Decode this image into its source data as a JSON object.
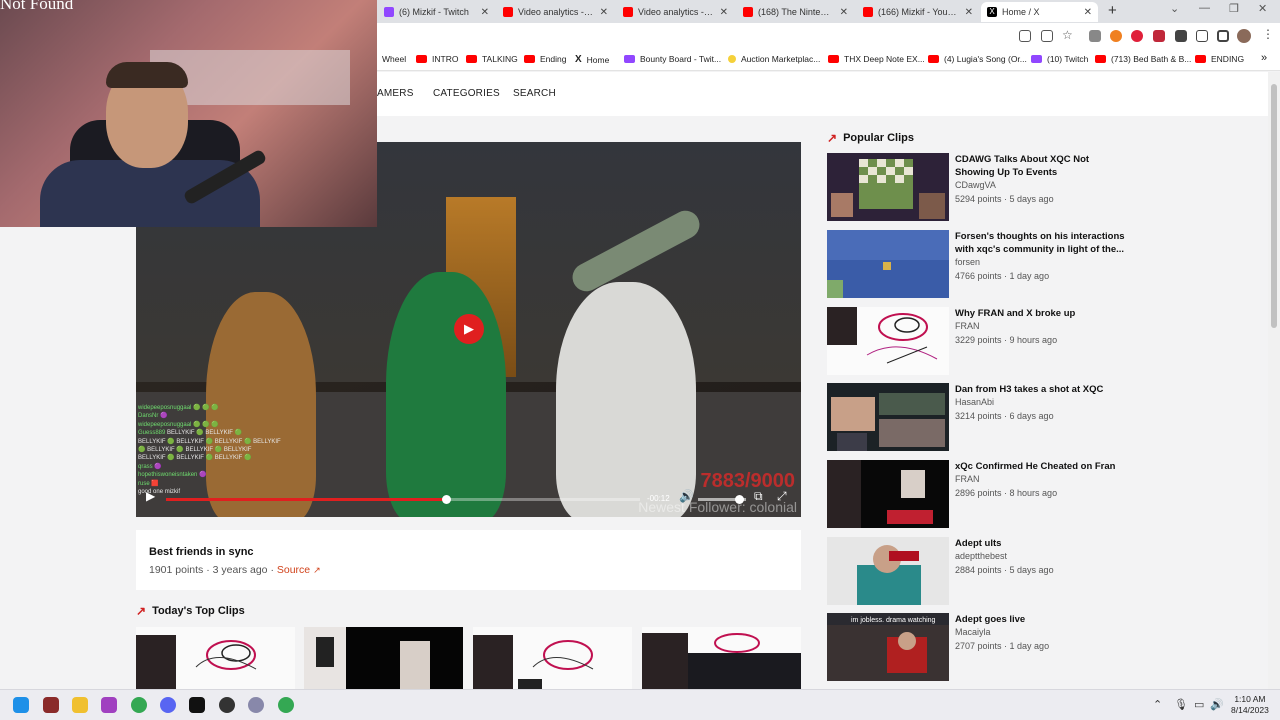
{
  "browser": {
    "tabs": [
      {
        "title": "(6) Mizkif - Twitch",
        "color": "#9147ff"
      },
      {
        "title": "Video analytics - YouTube",
        "color": "#ff0000"
      },
      {
        "title": "Video analytics - YouTube",
        "color": "#ff0000"
      },
      {
        "title": "(168) The Nintendo Ic",
        "color": "#ff0000"
      },
      {
        "title": "(166) Mizkif - YouTube",
        "color": "#ff0000"
      },
      {
        "title": "Home / X",
        "color": "#000000"
      }
    ],
    "new_tab": "+",
    "window_controls": [
      "⌄",
      "—",
      "❐",
      "✕"
    ]
  },
  "bookmarks": [
    {
      "label": "Wheel",
      "icon": "none"
    },
    {
      "label": "INTRO",
      "icon": "youtube"
    },
    {
      "label": "TALKING",
      "icon": "youtube"
    },
    {
      "label": "Ending",
      "icon": "youtube"
    },
    {
      "label": "Home",
      "icon": "x"
    },
    {
      "label": "Bounty Board - Twit...",
      "icon": "twitch"
    },
    {
      "label": "Auction Marketplac...",
      "icon": "bulb"
    },
    {
      "label": "THX Deep Note EX...",
      "icon": "youtube"
    },
    {
      "label": "(4) Lugia's Song (Or...",
      "icon": "youtube"
    },
    {
      "label": "(10) Twitch",
      "icon": "twitch"
    },
    {
      "label": "(713) Bed Bath & B...",
      "icon": "youtube"
    },
    {
      "label": "ENDING",
      "icon": "youtube"
    },
    {
      "label": "»",
      "icon": "none"
    }
  ],
  "nav": {
    "streamers": "AMERS",
    "categories": "CATEGORIES",
    "search": "SEARCH"
  },
  "webcam": {
    "overlay_text": "Not Found"
  },
  "player": {
    "chat": [
      {
        "user": "widepeeposnuggaal",
        "msg": "🟢 🟢 🟢"
      },
      {
        "user": "DansNr",
        "msg": "🟣"
      },
      {
        "user": "widepeeposnuggaal",
        "msg": "🟢 🟢 🟢"
      },
      {
        "user": "Guess889",
        "msg": "BELLYKIF 🟢 BELLYKIF 🟢"
      },
      {
        "user": "",
        "msg": "BELLYKIF 🟢 BELLYKIF 🟢 BELLYKIF 🟢 BELLYKIF"
      },
      {
        "user": "",
        "msg": "🟢 BELLYKIF 🟢 BELLYKIF 🟢 BELLYKIF"
      },
      {
        "user": "",
        "msg": "BELLYKIF 🟢 BELLYKIF 🟢 BELLYKIF 🟢"
      },
      {
        "user": "qrass",
        "msg": "🟣"
      },
      {
        "user": "hopethiswoneisntaken",
        "msg": "🟣"
      },
      {
        "user": "ruse",
        "msg": "🟥"
      },
      {
        "user": "",
        "msg": "good one mizkif"
      }
    ],
    "sub_count": "7883/9000",
    "follower_text": "Newest Follower: colonial",
    "time_remaining": "-00:12",
    "progress_fraction": 0.59,
    "volume_fraction": 0.85
  },
  "clip": {
    "title": "Best friends in sync",
    "points": "1901 points",
    "age": "3 years ago",
    "separator": "·",
    "source_label": "Source",
    "source_icon": "external-link-icon"
  },
  "top_clips": {
    "heading": "Today's Top Clips"
  },
  "popular": {
    "heading": "Popular Clips",
    "clips": [
      {
        "title": "CDAWG Talks About XQC Not Showing Up To Events",
        "author": "CDawgVA",
        "meta": "5294 points · 5 days ago"
      },
      {
        "title": "Forsen's thoughts on his interactions with xqc's community in light of the...",
        "author": "forsen",
        "meta": "4766 points · 1 day ago"
      },
      {
        "title": "Why FRAN and X broke up",
        "author": "FRAN",
        "meta": "3229 points · 9 hours ago"
      },
      {
        "title": "Dan from H3 takes a shot at XQC",
        "author": "HasanAbi",
        "meta": "3214 points · 6 days ago"
      },
      {
        "title": "xQc Confirmed He Cheated on Fran",
        "author": "FRAN",
        "meta": "2896 points · 8 hours ago"
      },
      {
        "title": "Adept ults",
        "author": "adeptthebest",
        "meta": "2884 points · 5 days ago"
      },
      {
        "title": "Adept goes live",
        "author": "Macaiyla",
        "meta": "2707 points · 1 day ago"
      }
    ],
    "thumb_caption": "im jobless. drama watching"
  },
  "taskbar": {
    "time": "1:10 AM",
    "date": "8/14/2023"
  },
  "colors": {
    "accent": "#d1431c",
    "trend": "#d02020",
    "youtube": "#ff0000",
    "twitch": "#9147ff"
  }
}
